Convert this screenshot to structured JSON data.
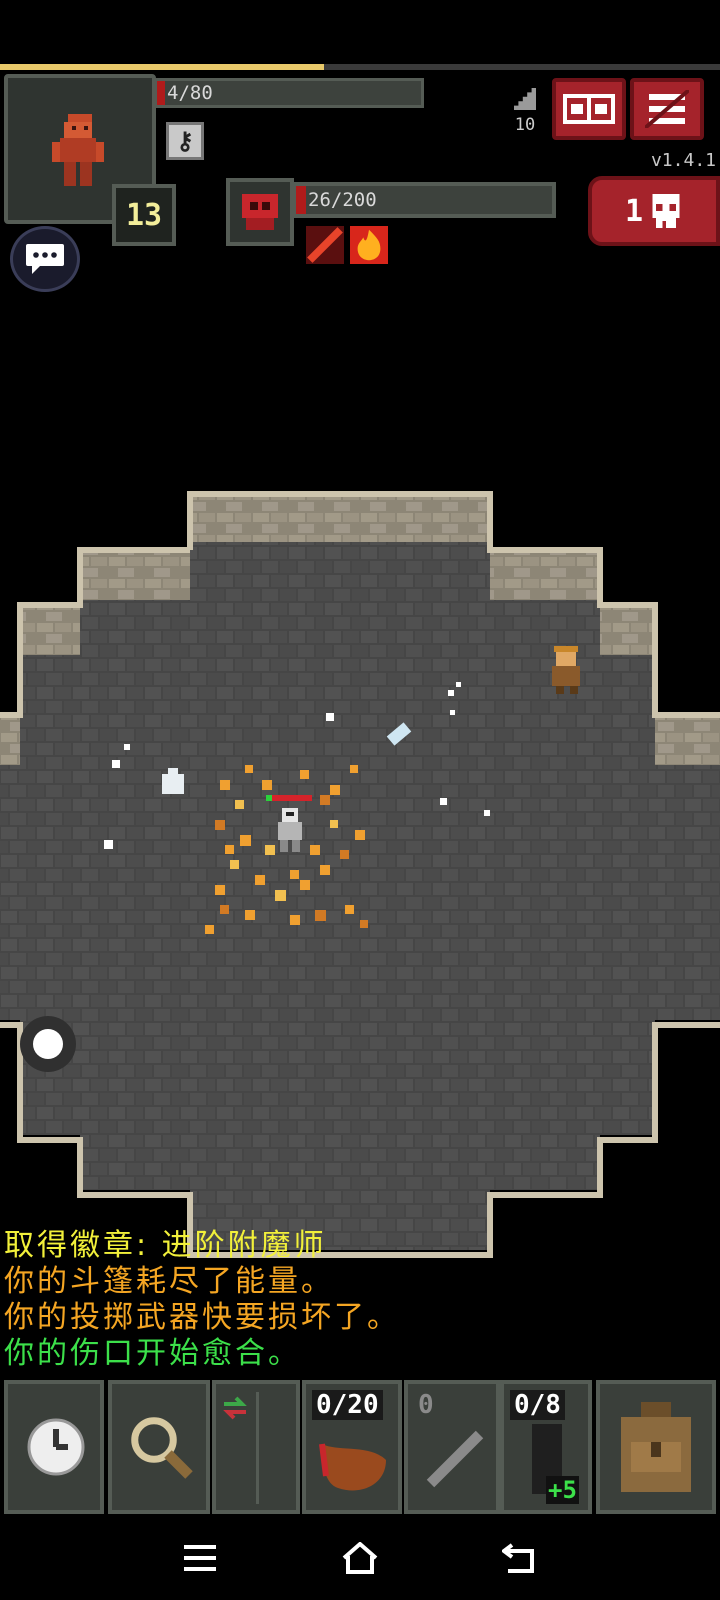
{
  "hud": {
    "hp_text": "4/80",
    "hero_level": "13",
    "depth": "10",
    "version": "v1.4.1",
    "danger_count": "1",
    "xp_fraction": 0.45
  },
  "enemy": {
    "hp_text": "26/200"
  },
  "log": {
    "lines": [
      {
        "text": "取得徽章: 进阶附魔师",
        "color": "#f2f03a"
      },
      {
        "text": "你的斗篷耗尽了能量。",
        "color": "#f5a623"
      },
      {
        "text": "你的投掷武器快要损坏了。",
        "color": "#f5a623"
      },
      {
        "text": "你的伤口开始愈合。",
        "color": "#3ce04a"
      }
    ]
  },
  "toolbar": {
    "quickslot1_label": "0/20",
    "quickslot2_label": "0",
    "quickslot3_label": "0/8",
    "quickslot3_bonus": "+5"
  },
  "icons": {
    "wait": "clock-icon",
    "search": "magnifier-icon",
    "swap": "swap-icon",
    "backpack": "backpack-icon",
    "chat": "chat-icon",
    "journal": "journal-icon",
    "menu": "menu-icon",
    "danger": "skull-icon"
  },
  "colors": {
    "accent_red": "#a5232b",
    "xp": "#e8c96a"
  }
}
